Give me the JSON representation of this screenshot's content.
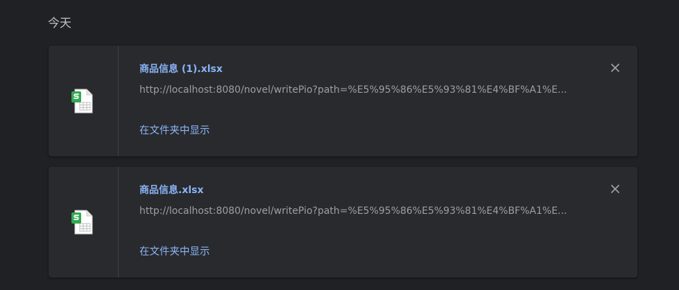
{
  "section": {
    "date_label": "今天"
  },
  "downloads": [
    {
      "file_name": "商品信息 (1).xlsx",
      "url": "http://localhost:8080/novel/writePio?path=%E5%95%86%E5%93%81%E4%BF%A1%E...",
      "show_in_folder": "在文件夹中显示",
      "icon": "spreadsheet-file-icon"
    },
    {
      "file_name": "商品信息.xlsx",
      "url": "http://localhost:8080/novel/writePio?path=%E5%95%86%E5%93%81%E4%BF%A1%E...",
      "show_in_folder": "在文件夹中显示",
      "icon": "spreadsheet-file-icon"
    }
  ],
  "colors": {
    "background": "#202124",
    "card": "#292a2d",
    "link": "#8ab4f8",
    "url_text": "#9aa0a6",
    "icon_green": "#34a853"
  }
}
